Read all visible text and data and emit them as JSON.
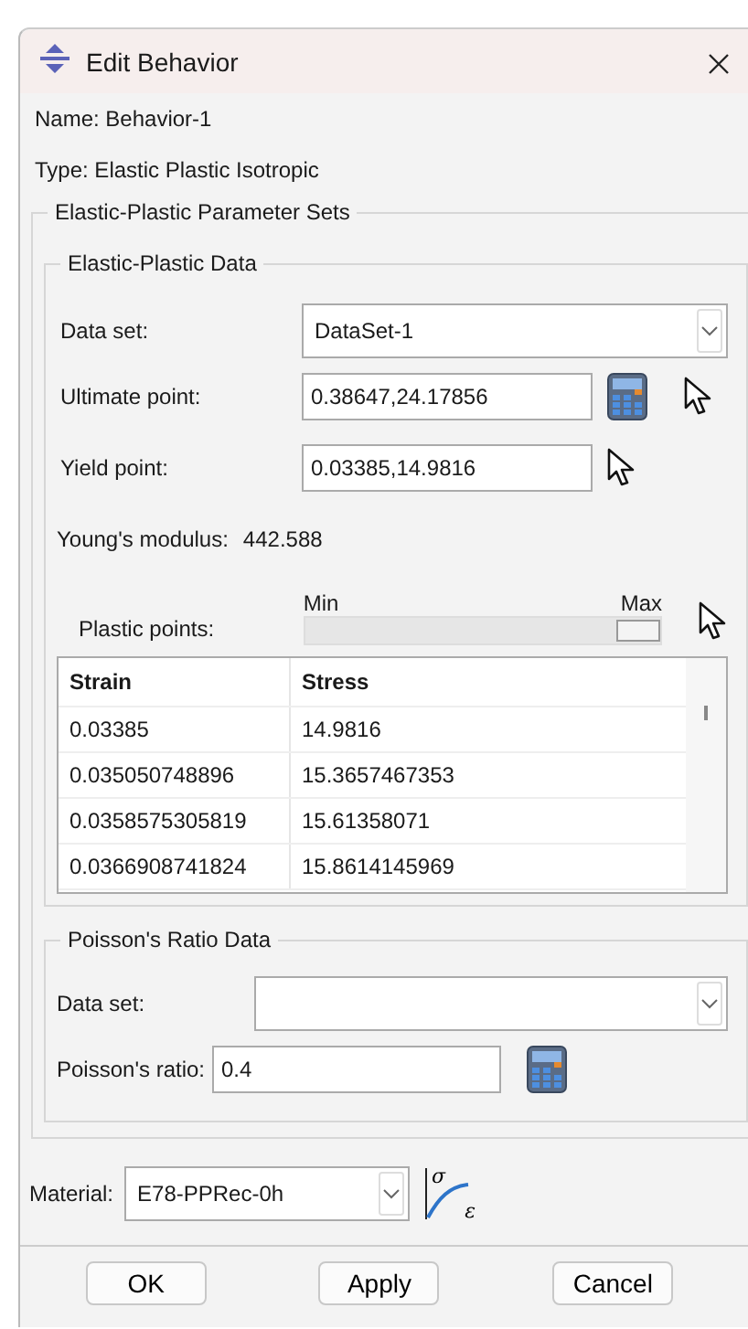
{
  "window": {
    "title": "Edit Behavior"
  },
  "name_label": "Name: Behavior-1",
  "type_label": "Type: Elastic Plastic Isotropic",
  "parameter_sets": {
    "title": "Elastic-Plastic Parameter Sets",
    "elastic_plastic_data": {
      "title": "Elastic-Plastic Data",
      "data_set": {
        "label": "Data set:",
        "value": "DataSet-1"
      },
      "ultimate_point": {
        "label": "Ultimate point:",
        "value": "0.38647,24.17856"
      },
      "yield_point": {
        "label": "Yield point:",
        "value": "0.03385,14.9816"
      },
      "youngs_modulus": {
        "label": "Young's modulus:",
        "value": "442.588"
      },
      "plastic_points": {
        "label": "Plastic points:",
        "min": "Min",
        "max": "Max",
        "level": 1
      },
      "table": {
        "columns": [
          "Strain",
          "Stress"
        ],
        "rows": [
          [
            "0.03385",
            "14.9816"
          ],
          [
            "0.035050748896",
            "15.3657467353"
          ],
          [
            "0.0358575305819",
            "15.61358071"
          ],
          [
            "0.0366908741824",
            "15.8614145969"
          ]
        ]
      }
    },
    "poisson_data": {
      "title": "Poisson's Ratio Data",
      "data_set": {
        "label": "Data set:"
      },
      "poissons_ratio": {
        "label": "Poisson's ratio:",
        "value": "0.4"
      }
    }
  },
  "material": {
    "label": "Material:",
    "value": "E78-PPRec-0h"
  },
  "curve_button": {
    "symbols": [
      "σ",
      "ε"
    ]
  },
  "buttons": [
    "OK",
    "Apply",
    "Cancel"
  ]
}
